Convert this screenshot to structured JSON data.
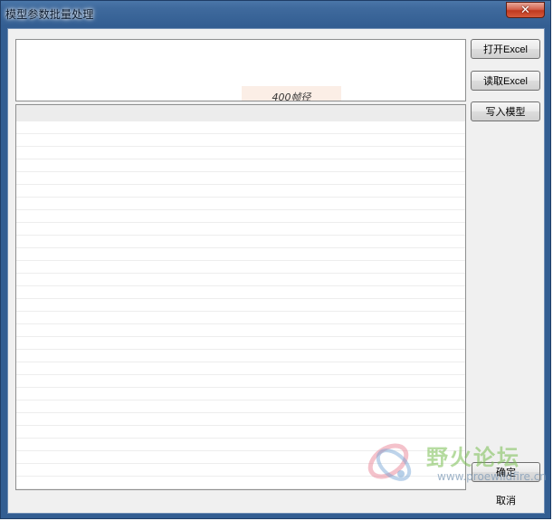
{
  "window": {
    "title": "模型参数批量处理",
    "close_symbol": "✕"
  },
  "preview": {
    "snippet_text": "400帧径"
  },
  "buttons": {
    "open_excel": "打开Excel",
    "read_excel": "读取Excel",
    "write_model": "写入模型",
    "ok": "确定",
    "cancel": "取消"
  },
  "watermark": {
    "brand": "野火论坛",
    "url": "www.proewildfire.cn"
  },
  "colors": {
    "titlebar": "#3f6a9d",
    "close_button": "#c0391f",
    "dialog_background": "#f0f0f0"
  }
}
